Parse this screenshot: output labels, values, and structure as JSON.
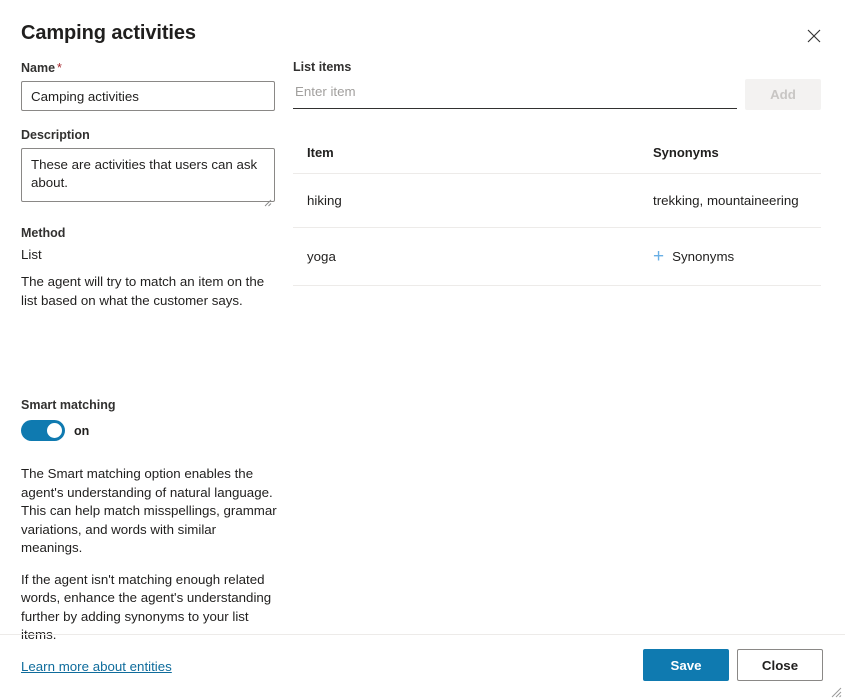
{
  "dialog": {
    "title": "Camping activities",
    "close_icon": "close-icon"
  },
  "form": {
    "name": {
      "label": "Name",
      "required_marker": "*",
      "value": "Camping activities"
    },
    "description": {
      "label": "Description",
      "value": "These are activities that users can ask about."
    },
    "method": {
      "label": "Method",
      "value": "List",
      "help": "The agent will try to match an item on the list based on what the customer says."
    },
    "smart_matching": {
      "label": "Smart matching",
      "state": "on",
      "enabled": true,
      "paragraph_1": "The Smart matching option enables the agent's understanding of natural language. This can help match misspellings, grammar variations, and words with similar meanings.",
      "paragraph_2": "If the agent isn't matching enough related words, enhance the agent's understanding further by adding synonyms to your list items.",
      "learn_more": "Learn more about entities"
    }
  },
  "list_items": {
    "label": "List items",
    "input_placeholder": "Enter item",
    "input_value": "",
    "add_label": "Add",
    "add_disabled": true,
    "columns": [
      "Item",
      "Synonyms"
    ],
    "rows": [
      {
        "item": "hiking",
        "synonyms": "trekking, mountaineering",
        "has_add_link": false
      },
      {
        "item": "yoga",
        "synonyms": "",
        "has_add_link": true,
        "add_link_label": "Synonyms"
      }
    ]
  },
  "footer": {
    "save_label": "Save",
    "close_label": "Close"
  },
  "colors": {
    "accent": "#0f7ab0",
    "link": "#0f6c9c",
    "required": "#a4262c",
    "plus": "#69afe5"
  }
}
